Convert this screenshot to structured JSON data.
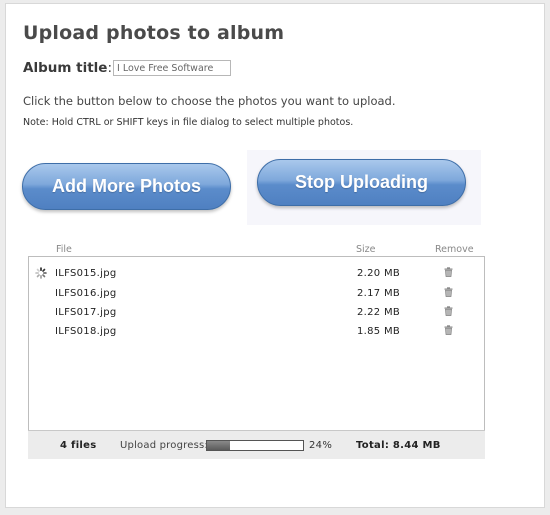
{
  "page": {
    "title": "Upload photos to album",
    "album_title_label": "Album title",
    "album_title_colon": ":",
    "album_title_value": "I Love Free Software",
    "instructions": "Click the button below to choose the photos you want to upload.",
    "note": "Note: Hold CTRL or SHIFT keys in file dialog to select multiple photos."
  },
  "buttons": {
    "add_more": "Add More Photos",
    "stop": "Stop Uploading"
  },
  "table": {
    "headers": {
      "file": "File",
      "size": "Size",
      "remove": "Remove"
    },
    "rows": [
      {
        "name": "ILFS015.jpg",
        "size": "2.20 MB",
        "uploading": true
      },
      {
        "name": "ILFS016.jpg",
        "size": "2.17 MB",
        "uploading": false
      },
      {
        "name": "ILFS017.jpg",
        "size": "2.22 MB",
        "uploading": false
      },
      {
        "name": "ILFS018.jpg",
        "size": "1.85 MB",
        "uploading": false
      }
    ],
    "row_icons": {
      "status": "loading-spinner-icon",
      "remove": "trash-icon"
    }
  },
  "footer": {
    "file_count": "4 files",
    "progress_label": "Upload progress:",
    "progress_value": 0.24,
    "progress_text": "24%",
    "total": "Total:  8.44 MB"
  },
  "colors": {
    "button_blue": "#5b8ccb",
    "progress_fill": "#5b5b5b"
  }
}
